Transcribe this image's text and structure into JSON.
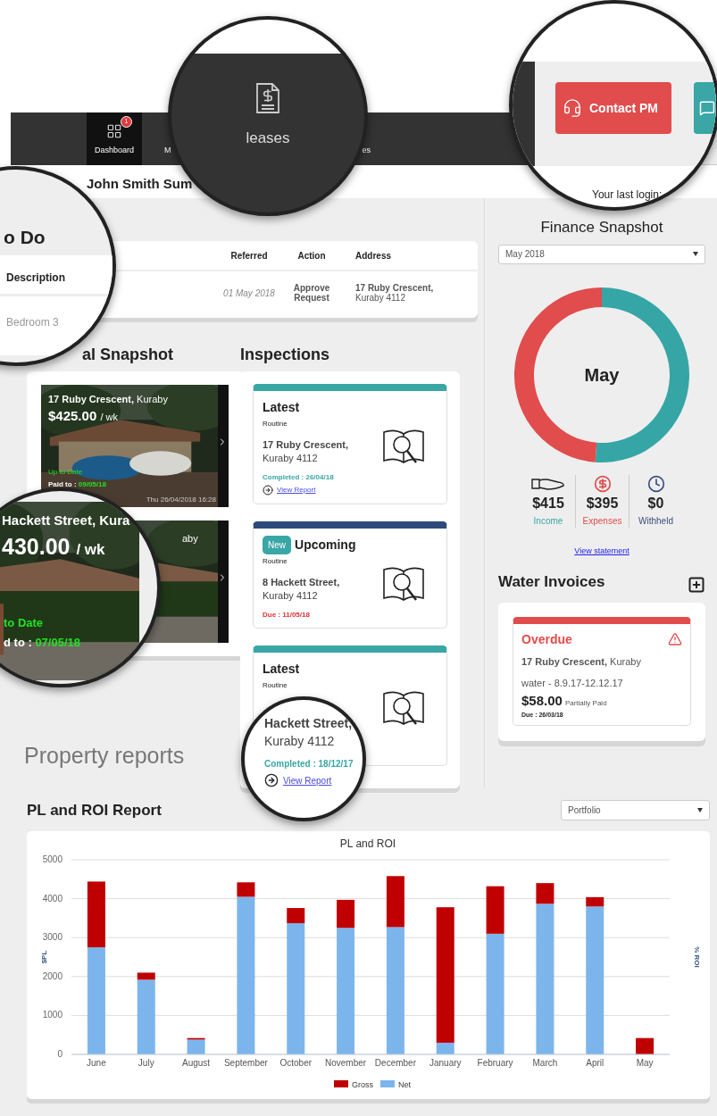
{
  "nav": {
    "items": [
      {
        "label": "Dashboard",
        "selected": true,
        "badge": "1",
        "kind": "grid"
      },
      {
        "label": "M",
        "selected": false,
        "kind": "none"
      },
      {
        "label": "es",
        "selected": false,
        "kind": "none"
      }
    ]
  },
  "leases_zoom": {
    "label": "leases"
  },
  "contact_zoom": {
    "button": "Contact PM"
  },
  "header": {
    "title": "John Smith Sum"
  },
  "login_zoom": {
    "last_login": "Your last login:"
  },
  "todo": {
    "title": "o Do",
    "columns": [
      "Description",
      "Referred",
      "Action",
      "Address"
    ],
    "rows": [
      {
        "description": "Bedroom 3",
        "referred": "01 May 2018",
        "action": "Approve Request",
        "street": "17 Ruby Crescent,",
        "suburb": "Kuraby 4112"
      }
    ]
  },
  "rental": {
    "title": "al Snapshot",
    "cards": [
      {
        "street": "17 Ruby Crescent,",
        "suburb": "Kuraby",
        "rent": "$425.00",
        "unit": "/ wk",
        "status": "Up to Date",
        "paid_label": "Paid to :",
        "paid": "09/05/18",
        "stamp": "Thu 26/04/2018 16:28"
      },
      {
        "suburb": "aby"
      }
    ],
    "zoom": {
      "street": "Hackett Street, Kura",
      "rent": "430.00",
      "unit": "/ wk",
      "status": "to Date",
      "paid_label": "d to :",
      "paid": "07/05/18"
    }
  },
  "property_reports": "Property reports",
  "inspections": {
    "title": "Inspections",
    "cards": [
      {
        "kind": "latest",
        "title": "Latest",
        "type": "Routine",
        "street": "17 Ruby Crescent,",
        "suburb": "Kuraby 4112",
        "status": "Completed : 26/04/18",
        "link": "View Report"
      },
      {
        "kind": "upcoming",
        "badge": "New",
        "title": "Upcoming",
        "type": "Routine",
        "street": "8 Hackett Street,",
        "suburb": "Kuraby 4112",
        "status": "Due : 11/05/18"
      },
      {
        "kind": "latest",
        "title": "Latest",
        "type": "Routine"
      }
    ],
    "zoom": {
      "street": "Hackett Street,",
      "suburb": "Kuraby 4112",
      "status": "Completed : 18/12/17",
      "link": "View Report"
    }
  },
  "finance": {
    "title": "Finance Snapshot",
    "period": "May 2018",
    "center": "May",
    "stats": [
      {
        "kind": "income",
        "amount": "$415",
        "label": "Income"
      },
      {
        "kind": "expenses",
        "amount": "$395",
        "label": "Expenses"
      },
      {
        "kind": "withheld",
        "amount": "$0",
        "label": "Withheld"
      }
    ],
    "link": "View statement"
  },
  "water": {
    "title": "Water Invoices",
    "invoice": {
      "status": "Overdue",
      "street": "17 Ruby Crescent,",
      "suburb": "Kuraby",
      "period": "water - 8.9.17-12.12.17",
      "amount": "$58.00",
      "note": "Partially Paid",
      "due": "Due : 26/03/18"
    }
  },
  "report": {
    "title": "PL and ROI Report",
    "filter": "Portfolio",
    "chart_data": {
      "type": "bar",
      "title": "PL and ROI",
      "grid": true,
      "legend": "bottom",
      "ylabel": "$PL",
      "y2label": "% ROI",
      "stacked": true,
      "categories": [
        "June",
        "July",
        "August",
        "September",
        "October",
        "November",
        "December",
        "January",
        "February",
        "March",
        "April",
        "May"
      ],
      "ylim": [
        0,
        5000
      ],
      "yticks": [
        0,
        1000,
        2000,
        3000,
        4000,
        5000
      ],
      "series": [
        {
          "name": "Net",
          "color": "#7cb5ec",
          "values": [
            2750,
            1920,
            380,
            4050,
            3370,
            3250,
            3270,
            300,
            3100,
            3870,
            3800,
            0
          ]
        },
        {
          "name": "Gross",
          "color": "#c00000",
          "values": [
            1690,
            180,
            40,
            370,
            390,
            720,
            1310,
            3480,
            1220,
            530,
            240,
            420
          ]
        }
      ]
    }
  }
}
